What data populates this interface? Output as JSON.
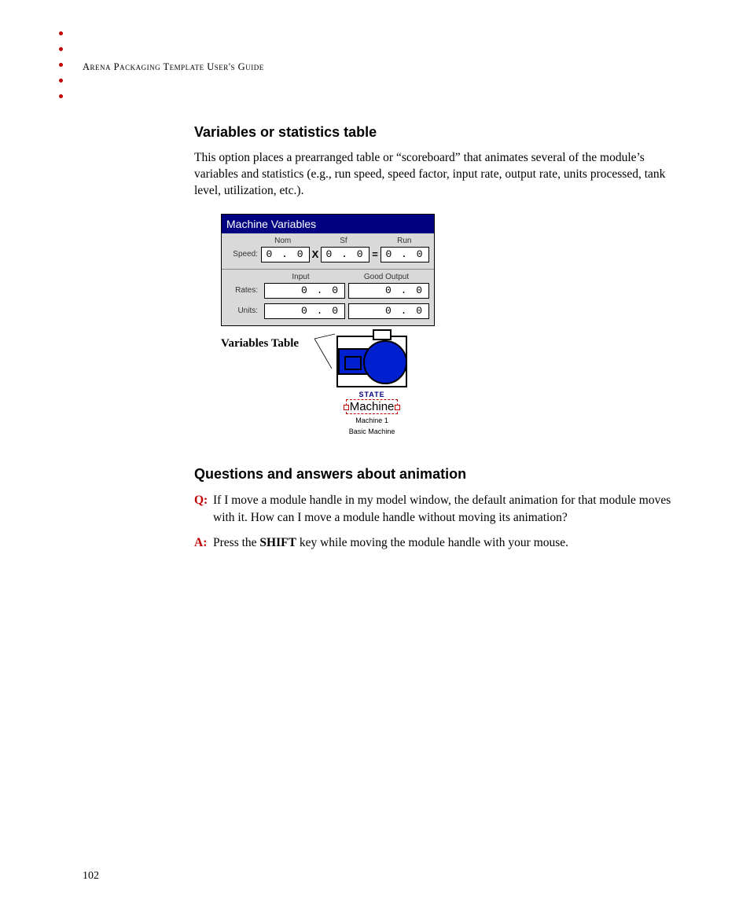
{
  "header": {
    "running_title": "Arena Packaging Template User's Guide"
  },
  "section1": {
    "heading": "Variables or statistics table",
    "paragraph": "This option places a prearranged table or “scoreboard” that animates several of the module’s variables and statistics (e.g., run speed, speed factor, input rate, output rate, units processed, tank level, utilization, etc.)."
  },
  "panel": {
    "title": "Machine Variables",
    "top": {
      "cols": [
        "Nom",
        "Sf",
        "Run"
      ],
      "row_label": "Speed:",
      "vals": [
        "0 . 0",
        "0 . 0",
        "0 . 0"
      ],
      "op1": "X",
      "op2": "="
    },
    "bottom": {
      "cols": [
        "Input",
        "Good Output"
      ],
      "rows": [
        {
          "label": "Rates:",
          "vals": [
            "0 . 0",
            "0 . 0"
          ]
        },
        {
          "label": "Units:",
          "vals": [
            "0 . 0",
            "0 . 0"
          ]
        }
      ]
    }
  },
  "figure": {
    "caption": "Variables Table",
    "state": "STATE",
    "name": "Machine",
    "sub1": "Machine 1",
    "sub2": "Basic Machine"
  },
  "section2": {
    "heading": "Questions and answers about animation",
    "q_tag": "Q:",
    "q_text": "If I move a module handle in my model window, the default animation for that module moves with it. How can I move a module handle without moving its animation?",
    "a_tag": "A:",
    "a_pre": "Press the ",
    "a_bold": "SHIFT",
    "a_post": " key while moving the module handle with your mouse."
  },
  "page_number": "102"
}
